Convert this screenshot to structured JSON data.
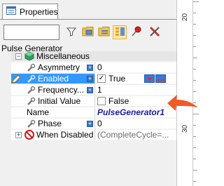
{
  "panel": {
    "tab_label": "Properties",
    "search_value": "",
    "object_name": "Pulse Generator"
  },
  "grid": {
    "category": "Miscellaneous",
    "rows": [
      {
        "name": "Asymmetry",
        "value": "0"
      },
      {
        "name": "Enabled",
        "value": "True",
        "checked": true
      },
      {
        "name": "Frequency...",
        "value": "1"
      },
      {
        "name": "Initial Value",
        "value": "False",
        "checked": false
      },
      {
        "name": "Name",
        "value": "PulseGenerator1"
      },
      {
        "name": "Phase",
        "value": "0"
      },
      {
        "name": "When Disabled",
        "value": "(CompleteCycle=..."
      }
    ]
  },
  "ruler": {
    "labels": [
      "20",
      "30"
    ]
  },
  "colors": {
    "selection": "#3399ff",
    "value_highlight": "#1a1aa6",
    "arrow": "#f05a28"
  }
}
